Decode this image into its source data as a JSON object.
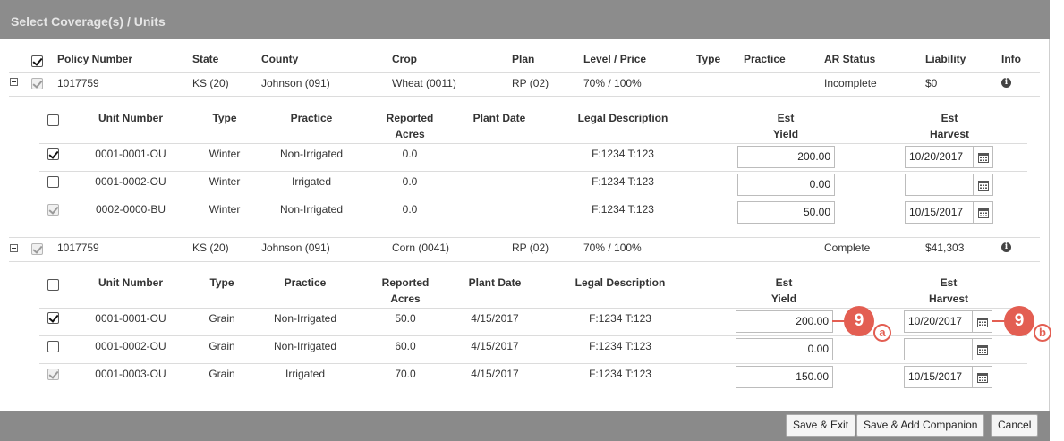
{
  "dialog": {
    "title": "Select Coverage(s) / Units"
  },
  "policy_columns": [
    "Policy Number",
    "State",
    "County",
    "Crop",
    "Plan",
    "Level / Price",
    "Type",
    "Practice",
    "AR Status",
    "Liability",
    "Info"
  ],
  "unit_columns": {
    "unit_number": "Unit Number",
    "type": "Type",
    "practice": "Practice",
    "reported_acres_1": "Reported",
    "reported_acres_2": "Acres",
    "plant_date": "Plant Date",
    "legal_description": "Legal Description",
    "est_yield_1": "Est",
    "est_yield_2": "Yield",
    "est_harvest_1": "Est",
    "est_harvest_2": "Harvest"
  },
  "policies": [
    {
      "policy_number": "1017759",
      "state": "KS (20)",
      "county": "Johnson (091)",
      "crop": "Wheat (0011)",
      "plan": "RP (02)",
      "level_price": "70% / 100%",
      "type": "",
      "practice": "",
      "ar_status": "Incomplete",
      "liability": "$0",
      "units": [
        {
          "unit_number": "0001-0001-OU",
          "type": "Winter",
          "practice": "Non-Irrigated",
          "reported_acres": "0.0",
          "plant_date": "",
          "legal_description": "F:1234 T:123",
          "est_yield": "200.00",
          "est_harvest": "10/20/2017"
        },
        {
          "unit_number": "0001-0002-OU",
          "type": "Winter",
          "practice": "Irrigated",
          "reported_acres": "0.0",
          "plant_date": "",
          "legal_description": "F:1234 T:123",
          "est_yield": "0.00",
          "est_harvest": ""
        },
        {
          "unit_number": "0002-0000-BU",
          "type": "Winter",
          "practice": "Non-Irrigated",
          "reported_acres": "0.0",
          "plant_date": "",
          "legal_description": "F:1234 T:123",
          "est_yield": "50.00",
          "est_harvest": "10/15/2017"
        }
      ]
    },
    {
      "policy_number": "1017759",
      "state": "KS (20)",
      "county": "Johnson (091)",
      "crop": "Corn (0041)",
      "plan": "RP (02)",
      "level_price": "70% / 100%",
      "type": "",
      "practice": "",
      "ar_status": "Complete",
      "liability": "$41,303",
      "units": [
        {
          "unit_number": "0001-0001-OU",
          "type": "Grain",
          "practice": "Non-Irrigated",
          "reported_acres": "50.0",
          "plant_date": "4/15/2017",
          "legal_description": "F:1234 T:123",
          "est_yield": "200.00",
          "est_harvest": "10/20/2017"
        },
        {
          "unit_number": "0001-0002-OU",
          "type": "Grain",
          "practice": "Non-Irrigated",
          "reported_acres": "60.0",
          "plant_date": "4/15/2017",
          "legal_description": "F:1234 T:123",
          "est_yield": "0.00",
          "est_harvest": ""
        },
        {
          "unit_number": "0001-0003-OU",
          "type": "Grain",
          "practice": "Irrigated",
          "reported_acres": "70.0",
          "plant_date": "4/15/2017",
          "legal_description": "F:1234 T:123",
          "est_yield": "150.00",
          "est_harvest": "10/15/2017"
        }
      ]
    }
  ],
  "callouts": [
    {
      "number": "9",
      "letter": "a"
    },
    {
      "number": "9",
      "letter": "b"
    }
  ],
  "footer": {
    "save_exit": "Save & Exit",
    "save_add_companion": "Save & Add Companion",
    "cancel": "Cancel"
  },
  "icons": {
    "info": "info-icon",
    "calendar": "calendar-icon",
    "collapse": "collapse-icon"
  },
  "colors": {
    "titlebar": "#8c8c8c",
    "callout": "#e35e52"
  }
}
